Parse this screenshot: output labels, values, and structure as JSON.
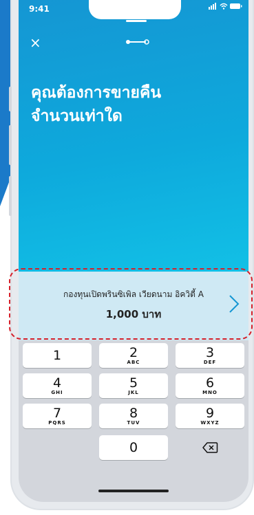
{
  "status": {
    "time": "9:41"
  },
  "header": {
    "close_label": "×"
  },
  "headline": {
    "line1": "คุณต้องการขายคืน",
    "line2": "จำนวนเท่าใด"
  },
  "fund": {
    "name": "กองทุนเปิดพรินซิเพิล เวียดนาม อิควิตี้ A",
    "amount": "1,000 บาท"
  },
  "keypad": {
    "keys": [
      {
        "num": "1",
        "letters": ""
      },
      {
        "num": "2",
        "letters": "ABC"
      },
      {
        "num": "3",
        "letters": "DEF"
      },
      {
        "num": "4",
        "letters": "GHI"
      },
      {
        "num": "5",
        "letters": "JKL"
      },
      {
        "num": "6",
        "letters": "MNO"
      },
      {
        "num": "7",
        "letters": "PQRS"
      },
      {
        "num": "8",
        "letters": "TUV"
      },
      {
        "num": "9",
        "letters": "WXYZ"
      },
      {
        "num": "0",
        "letters": ""
      }
    ],
    "delete_icon": "backspace-icon"
  },
  "colors": {
    "primary": "#1596d3",
    "highlight": "#d6202a",
    "card": "#cfe9f4"
  }
}
